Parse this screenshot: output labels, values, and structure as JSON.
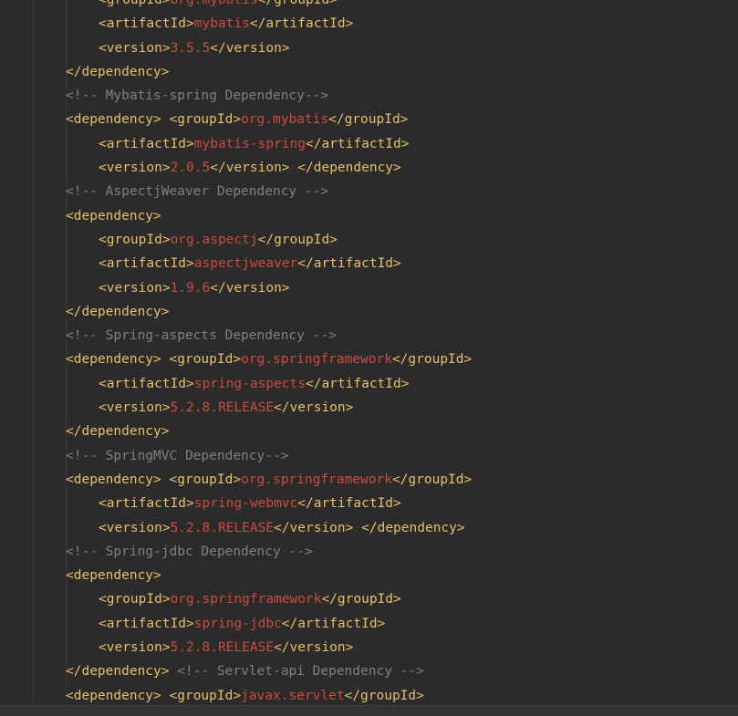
{
  "editor": {
    "language": "xml",
    "lines": [
      {
        "indent": 2,
        "segments": [
          {
            "t": "tag",
            "v": "<groupId>"
          },
          {
            "t": "val",
            "v": "org.mybatis"
          },
          {
            "t": "tag",
            "v": "</groupId>"
          }
        ]
      },
      {
        "indent": 2,
        "segments": [
          {
            "t": "tag",
            "v": "<artifactId>"
          },
          {
            "t": "val",
            "v": "mybatis"
          },
          {
            "t": "tag",
            "v": "</artifactId>"
          }
        ]
      },
      {
        "indent": 2,
        "segments": [
          {
            "t": "tag",
            "v": "<version>"
          },
          {
            "t": "val",
            "v": "3.5.5"
          },
          {
            "t": "tag",
            "v": "</version>"
          }
        ]
      },
      {
        "indent": 1,
        "segments": [
          {
            "t": "tag",
            "v": "</dependency>"
          }
        ]
      },
      {
        "indent": 1,
        "segments": [
          {
            "t": "cmt",
            "v": "<!-- Mybatis-spring Dependency-->"
          }
        ]
      },
      {
        "indent": 1,
        "segments": [
          {
            "t": "tag",
            "v": "<dependency>"
          },
          {
            "t": "pln",
            "v": " "
          },
          {
            "t": "tag",
            "v": "<groupId>"
          },
          {
            "t": "val",
            "v": "org.mybatis"
          },
          {
            "t": "tag",
            "v": "</groupId>"
          }
        ]
      },
      {
        "indent": 2,
        "segments": [
          {
            "t": "tag",
            "v": "<artifactId>"
          },
          {
            "t": "val",
            "v": "mybatis-spring"
          },
          {
            "t": "tag",
            "v": "</artifactId>"
          }
        ]
      },
      {
        "indent": 2,
        "segments": [
          {
            "t": "tag",
            "v": "<version>"
          },
          {
            "t": "val",
            "v": "2.0.5"
          },
          {
            "t": "tag",
            "v": "</version>"
          },
          {
            "t": "pln",
            "v": " "
          },
          {
            "t": "tag",
            "v": "</dependency>"
          }
        ]
      },
      {
        "indent": 1,
        "segments": [
          {
            "t": "cmt",
            "v": "<!-- AspectjWeaver Dependency -->"
          }
        ]
      },
      {
        "indent": 1,
        "segments": [
          {
            "t": "tag",
            "v": "<dependency>"
          }
        ]
      },
      {
        "indent": 2,
        "segments": [
          {
            "t": "tag",
            "v": "<groupId>"
          },
          {
            "t": "val",
            "v": "org.aspectj"
          },
          {
            "t": "tag",
            "v": "</groupId>"
          }
        ]
      },
      {
        "indent": 2,
        "segments": [
          {
            "t": "tag",
            "v": "<artifactId>"
          },
          {
            "t": "val",
            "v": "aspectjweaver"
          },
          {
            "t": "tag",
            "v": "</artifactId>"
          }
        ]
      },
      {
        "indent": 2,
        "segments": [
          {
            "t": "tag",
            "v": "<version>"
          },
          {
            "t": "val",
            "v": "1.9.6"
          },
          {
            "t": "tag",
            "v": "</version>"
          }
        ]
      },
      {
        "indent": 1,
        "segments": [
          {
            "t": "tag",
            "v": "</dependency>"
          }
        ]
      },
      {
        "indent": 1,
        "segments": [
          {
            "t": "cmt",
            "v": "<!-- Spring-aspects Dependency -->"
          }
        ]
      },
      {
        "indent": 1,
        "segments": [
          {
            "t": "tag",
            "v": "<dependency>"
          },
          {
            "t": "pln",
            "v": " "
          },
          {
            "t": "tag",
            "v": "<groupId>"
          },
          {
            "t": "val",
            "v": "org.springframework"
          },
          {
            "t": "tag",
            "v": "</groupId>"
          }
        ]
      },
      {
        "indent": 2,
        "segments": [
          {
            "t": "tag",
            "v": "<artifactId>"
          },
          {
            "t": "val",
            "v": "spring-aspects"
          },
          {
            "t": "tag",
            "v": "</artifactId>"
          }
        ]
      },
      {
        "indent": 2,
        "segments": [
          {
            "t": "tag",
            "v": "<version>"
          },
          {
            "t": "val",
            "v": "5.2.8.RELEASE"
          },
          {
            "t": "tag",
            "v": "</version>"
          }
        ]
      },
      {
        "indent": 1,
        "segments": [
          {
            "t": "tag",
            "v": "</dependency>"
          }
        ]
      },
      {
        "indent": 1,
        "segments": [
          {
            "t": "cmt",
            "v": "<!-- SpringMVC Dependency-->"
          }
        ]
      },
      {
        "indent": 1,
        "segments": [
          {
            "t": "tag",
            "v": "<dependency>"
          },
          {
            "t": "pln",
            "v": " "
          },
          {
            "t": "tag",
            "v": "<groupId>"
          },
          {
            "t": "val",
            "v": "org.springframework"
          },
          {
            "t": "tag",
            "v": "</groupId>"
          }
        ]
      },
      {
        "indent": 2,
        "segments": [
          {
            "t": "tag",
            "v": "<artifactId>"
          },
          {
            "t": "val",
            "v": "spring-webmvc"
          },
          {
            "t": "tag",
            "v": "</artifactId>"
          }
        ]
      },
      {
        "indent": 2,
        "segments": [
          {
            "t": "tag",
            "v": "<version>"
          },
          {
            "t": "val",
            "v": "5.2.8.RELEASE"
          },
          {
            "t": "tag",
            "v": "</version>"
          },
          {
            "t": "pln",
            "v": " "
          },
          {
            "t": "tag",
            "v": "</dependency>"
          }
        ]
      },
      {
        "indent": 1,
        "segments": [
          {
            "t": "cmt",
            "v": "<!-- Spring-jdbc Dependency -->"
          }
        ]
      },
      {
        "indent": 1,
        "segments": [
          {
            "t": "tag",
            "v": "<dependency>"
          }
        ]
      },
      {
        "indent": 2,
        "segments": [
          {
            "t": "tag",
            "v": "<groupId>"
          },
          {
            "t": "val",
            "v": "org.springframework"
          },
          {
            "t": "tag",
            "v": "</groupId>"
          }
        ]
      },
      {
        "indent": 2,
        "segments": [
          {
            "t": "tag",
            "v": "<artifactId>"
          },
          {
            "t": "val",
            "v": "spring-jdbc"
          },
          {
            "t": "tag",
            "v": "</artifactId>"
          }
        ]
      },
      {
        "indent": 2,
        "segments": [
          {
            "t": "tag",
            "v": "<version>"
          },
          {
            "t": "val",
            "v": "5.2.8.RELEASE"
          },
          {
            "t": "tag",
            "v": "</version>"
          }
        ]
      },
      {
        "indent": 1,
        "segments": [
          {
            "t": "tag",
            "v": "</dependency>"
          },
          {
            "t": "pln",
            "v": " "
          },
          {
            "t": "cmt",
            "v": "<!-- Servlet-api Dependency -->"
          }
        ]
      },
      {
        "indent": 1,
        "segments": [
          {
            "t": "tag",
            "v": "<dependency>"
          },
          {
            "t": "pln",
            "v": " "
          },
          {
            "t": "tag",
            "v": "<groupId>"
          },
          {
            "t": "val",
            "v": "javax.servlet"
          },
          {
            "t": "tag",
            "v": "</groupId>"
          }
        ]
      }
    ]
  },
  "colors": {
    "background": "#2b2b2b",
    "tag": "#e8bf6a",
    "value": "#cc4b3f",
    "comment": "#808080",
    "indent_guide": "#3a3a3a",
    "scrollbar": "#313335"
  }
}
